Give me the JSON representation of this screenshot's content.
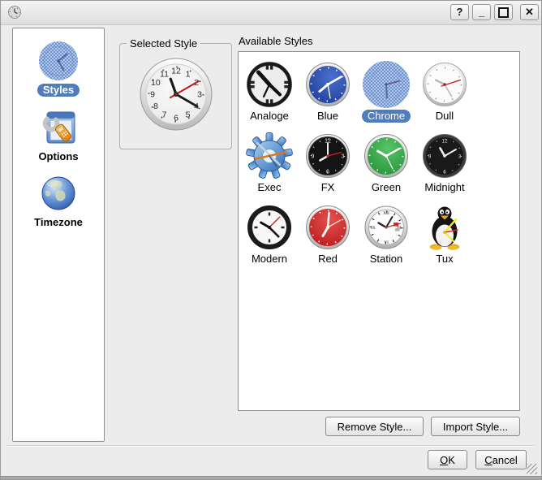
{
  "window": {
    "title": "",
    "controls": {
      "help": "?",
      "minimize": "_",
      "close": "✕"
    }
  },
  "sidebar": {
    "items": [
      {
        "label": "Styles",
        "selected": true
      },
      {
        "label": "Options",
        "selected": false
      },
      {
        "label": "Timezone",
        "selected": false
      }
    ]
  },
  "selected_style": {
    "group_label": "Selected Style"
  },
  "available": {
    "label": "Available Styles",
    "items": [
      {
        "label": "Analoge",
        "selected": false
      },
      {
        "label": "Blue",
        "selected": false
      },
      {
        "label": "Chrome",
        "selected": true
      },
      {
        "label": "Dull",
        "selected": false
      },
      {
        "label": "Exec",
        "selected": false
      },
      {
        "label": "FX",
        "selected": false
      },
      {
        "label": "Green",
        "selected": false
      },
      {
        "label": "Midnight",
        "selected": false
      },
      {
        "label": "Modern",
        "selected": false
      },
      {
        "label": "Red",
        "selected": false
      },
      {
        "label": "Station",
        "selected": false
      },
      {
        "label": "Tux",
        "selected": false
      }
    ]
  },
  "buttons": {
    "remove": "Remove Style...",
    "import": "Import Style...",
    "ok": "OK",
    "cancel": "Cancel"
  },
  "colors": {
    "selection_blue": "#4f7dbe",
    "dialog_bg": "#ececec"
  }
}
